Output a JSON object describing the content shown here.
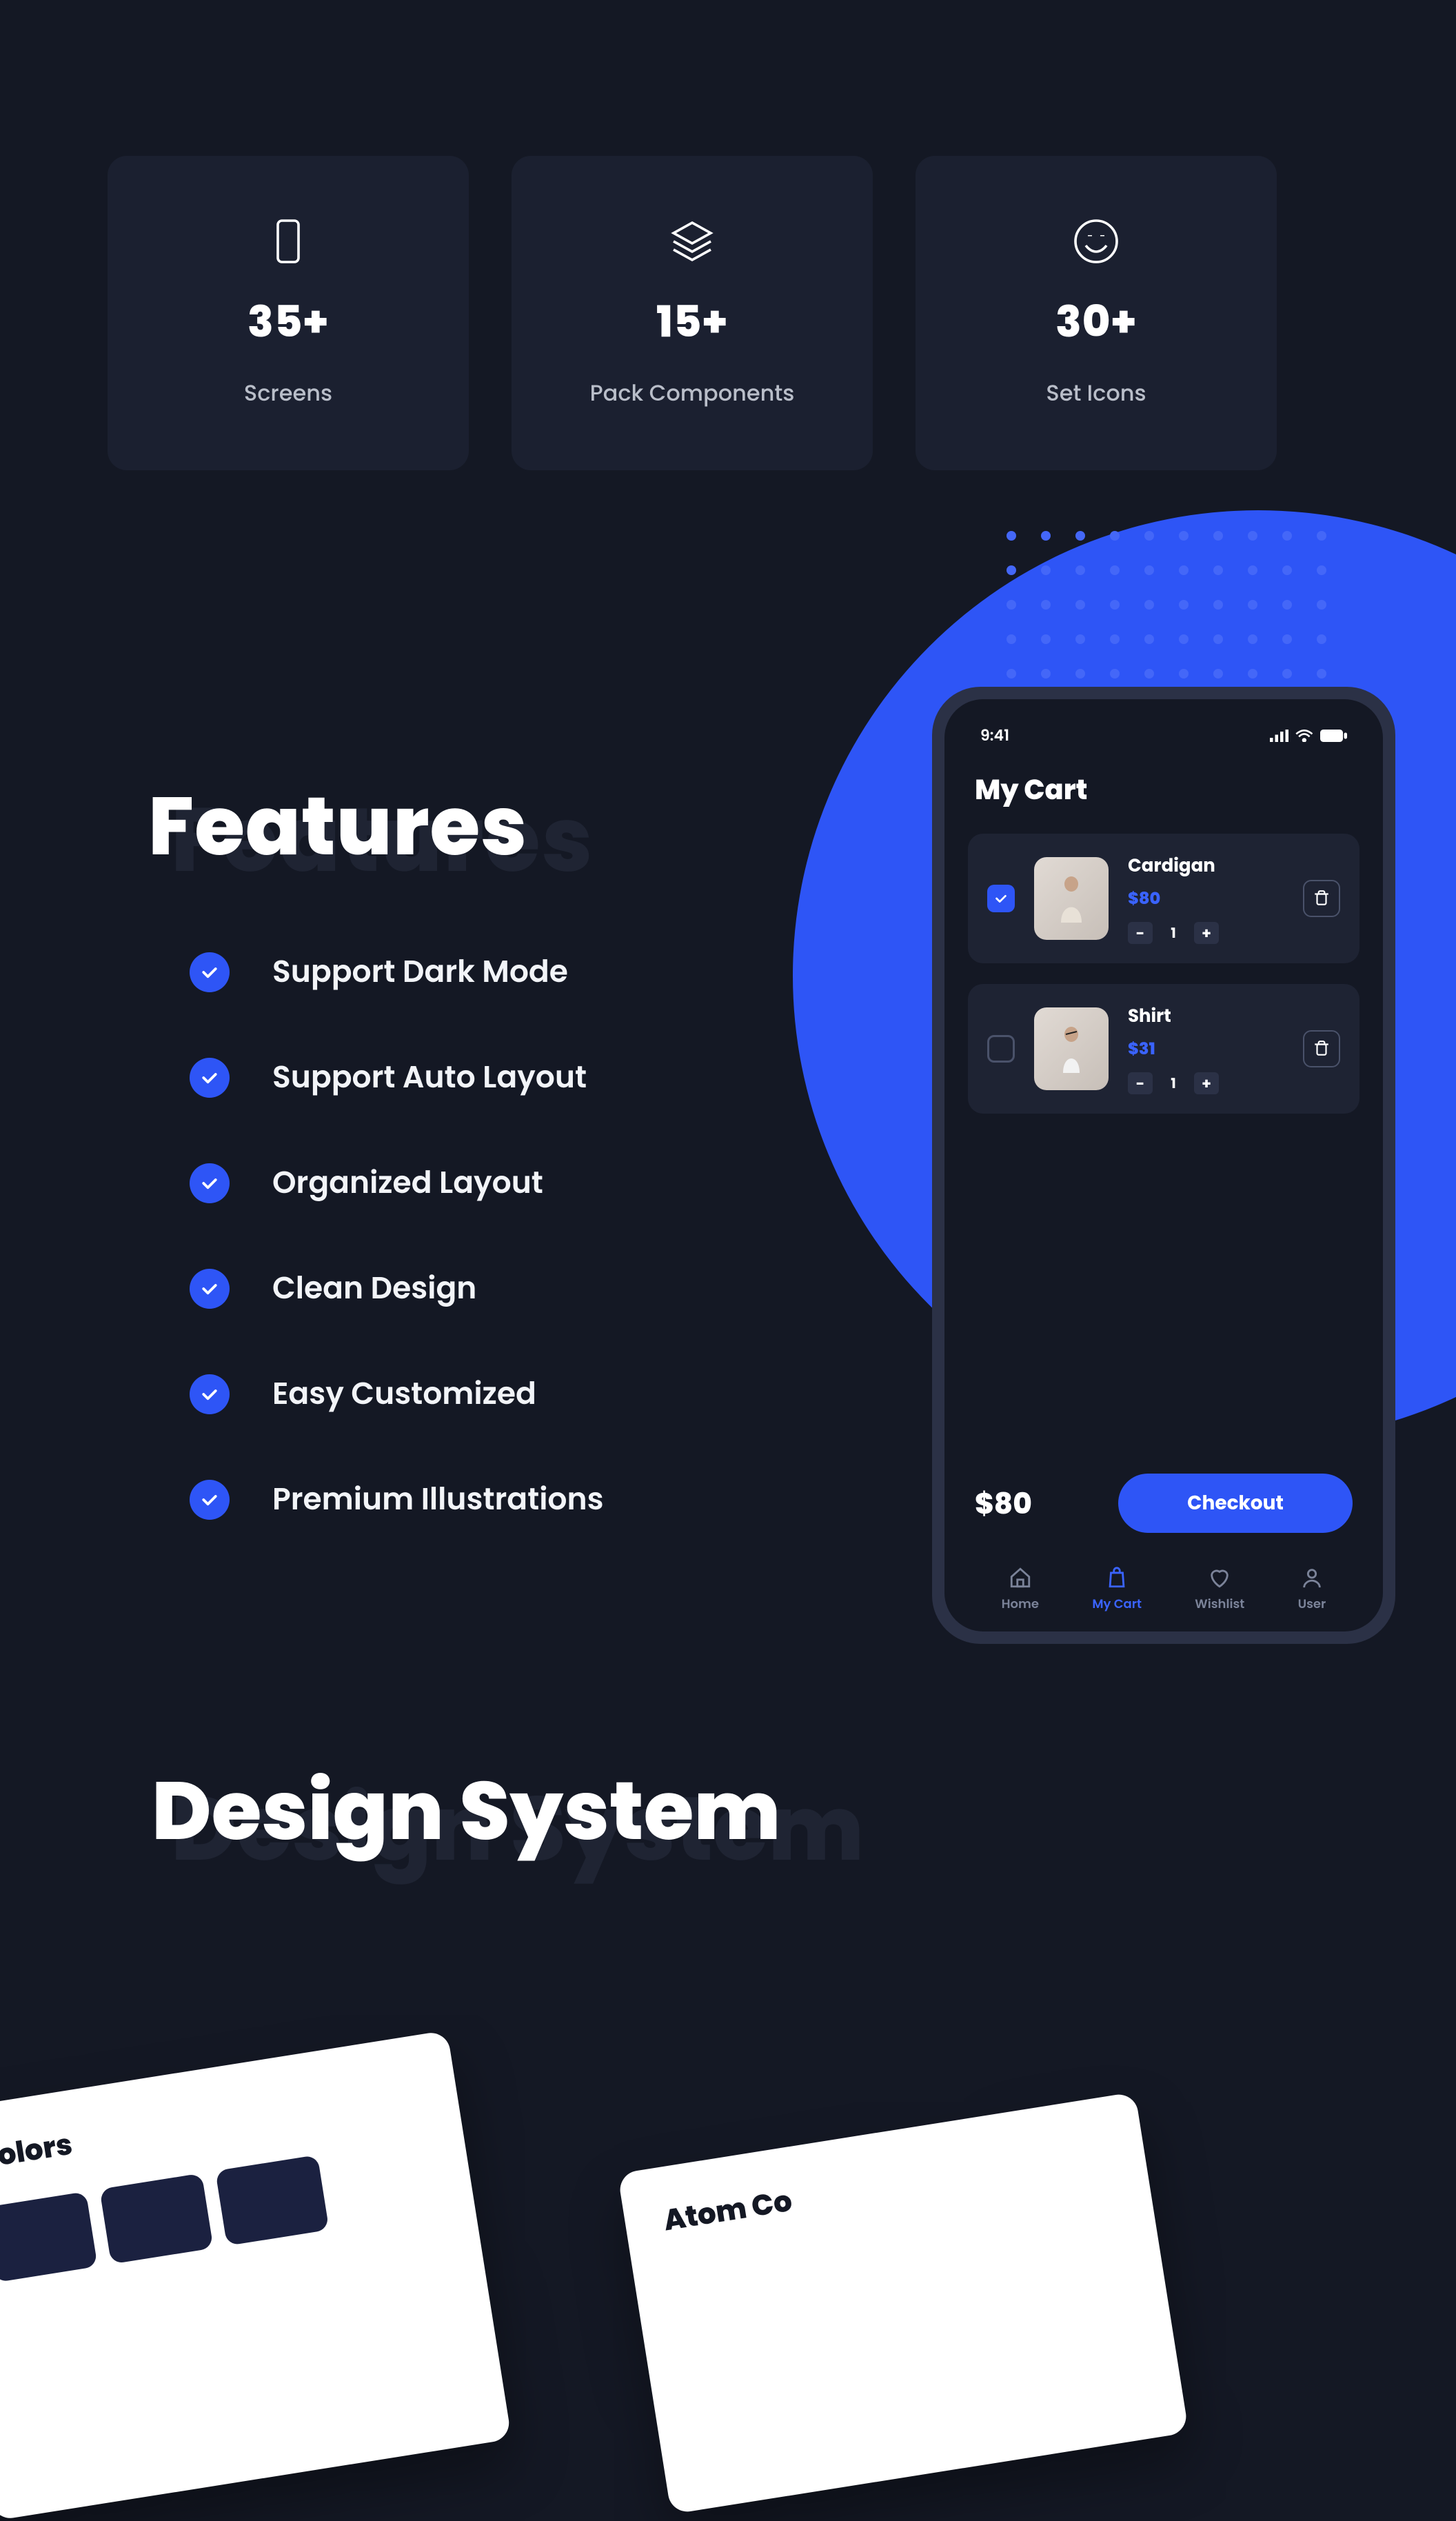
{
  "stats": [
    {
      "icon": "phone-icon",
      "number": "35+",
      "label": "Screens"
    },
    {
      "icon": "layers-icon",
      "number": "15+",
      "label": "Pack Components"
    },
    {
      "icon": "smile-icon",
      "number": "30+",
      "label": "Set Icons"
    }
  ],
  "features": {
    "heading": "Features",
    "items": [
      "Support Dark Mode",
      "Support Auto Layout",
      "Organized Layout",
      "Clean Design",
      "Easy Customized",
      "Premium Illustrations"
    ]
  },
  "phone": {
    "status_time": "9:41",
    "title": "My Cart",
    "items": [
      {
        "checked": true,
        "name": "Cardigan",
        "price": "$80",
        "qty": "1"
      },
      {
        "checked": false,
        "name": "Shirt",
        "price": "$31",
        "qty": "1"
      }
    ],
    "total": "$80",
    "checkout_label": "Checkout",
    "nav": [
      {
        "label": "Home",
        "icon": "home-icon",
        "active": false
      },
      {
        "label": "My Cart",
        "icon": "bag-icon",
        "active": true
      },
      {
        "label": "Wishlist",
        "icon": "heart-icon",
        "active": false
      },
      {
        "label": "User",
        "icon": "user-icon",
        "active": false
      }
    ]
  },
  "design_system": {
    "heading": "Design System",
    "cards": {
      "colors_title": "Colors",
      "atom_title_partial": "Atom Co"
    }
  }
}
